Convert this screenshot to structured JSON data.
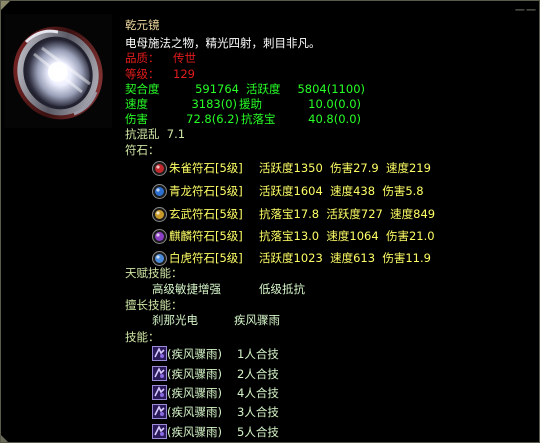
{
  "corner_mark": "一 一",
  "item": {
    "name": "乾元镜",
    "description": "电母施法之物，精光四射，刺目非凡。",
    "quality_label": "品质：",
    "quality_value": "传世",
    "level_label": "等级：",
    "level_value": "129"
  },
  "stats": [
    {
      "label1": "契合度",
      "value1": "591764",
      "label2": "活跃度",
      "value2": "5804(1100)"
    },
    {
      "label1": "速度",
      "value1": "3183(0)",
      "label2": "援助",
      "value2": "10.0(0.0)"
    },
    {
      "label1": "伤害",
      "value1": "72.8(6.2)",
      "label2": "抗落宝",
      "value2": "40.8(0.0)"
    }
  ],
  "extra_stat": "抗混乱  7.1",
  "runes_header": "符石：",
  "runes": [
    {
      "name": "朱雀符石[5级]",
      "stats": "活跃度1350  伤害27.9  速度219",
      "icon": "vermilion-bird-rune-icon",
      "color": "#c0282c"
    },
    {
      "name": "青龙符石[5级]",
      "stats": "活跃度1604  速度438  伤害5.8",
      "icon": "azure-dragon-rune-icon",
      "color": "#2b6fd0"
    },
    {
      "name": "玄武符石[5级]",
      "stats": "抗落宝17.8  活跃度727  速度849",
      "icon": "black-tortoise-rune-icon",
      "color": "#c79a2a"
    },
    {
      "name": "麒麟符石[5级]",
      "stats": "抗落宝13.0  速度1064  伤害21.0",
      "icon": "qilin-rune-icon",
      "color": "#8a3fc4"
    },
    {
      "name": "白虎符石[5级]",
      "stats": "活跃度1023  速度613  伤害11.9",
      "icon": "white-tiger-rune-icon",
      "color": "#4a8ad8"
    }
  ],
  "talent": {
    "header": "天赋技能：",
    "skills": [
      "高级敏捷增强",
      "低级抵抗"
    ]
  },
  "specialty": {
    "header": "擅长技能：",
    "skills": [
      "刹那光电",
      "疾风骤雨"
    ]
  },
  "skills": {
    "header": "技能：",
    "items": [
      {
        "name": "(疾风骤雨)",
        "target": "1人合技"
      },
      {
        "name": "(疾风骤雨)",
        "target": "2人合技"
      },
      {
        "name": "(疾风骤雨)",
        "target": "4人合技"
      },
      {
        "name": "(疾风骤雨)",
        "target": "3人合技"
      },
      {
        "name": "(疾风骤雨)",
        "target": "5人合技"
      }
    ],
    "icon": "combo-skill-icon"
  }
}
